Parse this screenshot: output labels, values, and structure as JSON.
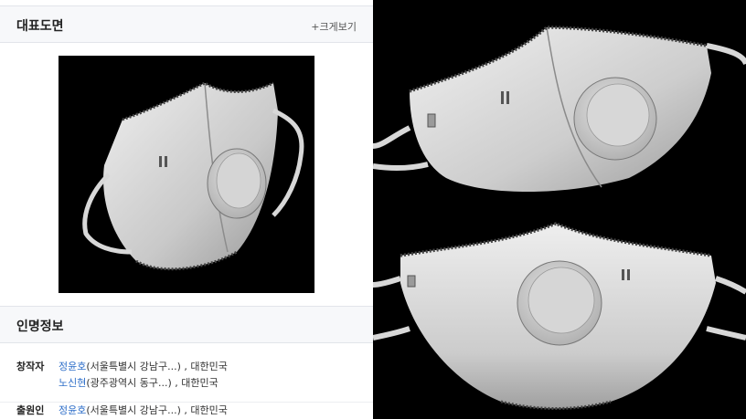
{
  "representative": {
    "title": "대표도면",
    "enlarge_label": "+크게보기"
  },
  "person_info": {
    "title": "인명정보",
    "inventor_label": "창작자",
    "inventors": [
      {
        "name": "정윤호",
        "detail": "(서울특별시 강남구...) , 대한민국"
      },
      {
        "name": "노신현",
        "detail": "(광주광역시 동구...) , 대한민국"
      }
    ],
    "applicant_label": "출원인",
    "applicants": [
      {
        "name": "정윤호",
        "detail": "(서울특별시 강남구...) , 대한민국"
      }
    ]
  }
}
